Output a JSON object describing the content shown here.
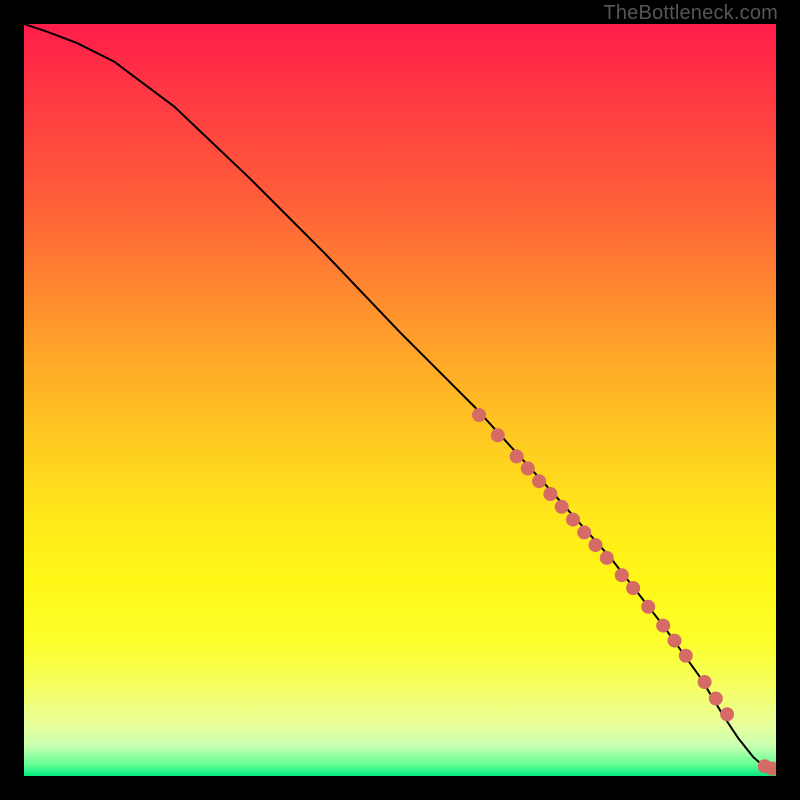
{
  "attribution": "TheBottleneck.com",
  "chart_data": {
    "type": "line",
    "title": "",
    "xlabel": "",
    "ylabel": "",
    "xlim": [
      0,
      100
    ],
    "ylim": [
      0,
      100
    ],
    "grid": false,
    "legend": false,
    "curve": {
      "name": "bottleneck-curve",
      "x": [
        0,
        3,
        7,
        12,
        20,
        30,
        40,
        50,
        60,
        70,
        78,
        85,
        90,
        93,
        95,
        97,
        98.5,
        100
      ],
      "y": [
        100,
        99,
        97.5,
        95,
        89,
        79.5,
        69.5,
        59,
        49,
        38,
        29,
        20,
        13,
        8,
        5,
        2.5,
        1.2,
        1.0
      ]
    },
    "points": {
      "name": "highlighted-samples",
      "color": "#d66a65",
      "xy": [
        [
          60.5,
          48.0
        ],
        [
          63.0,
          45.3
        ],
        [
          65.5,
          42.5
        ],
        [
          67.0,
          40.9
        ],
        [
          68.5,
          39.2
        ],
        [
          70.0,
          37.5
        ],
        [
          71.5,
          35.8
        ],
        [
          73.0,
          34.1
        ],
        [
          74.5,
          32.4
        ],
        [
          76.0,
          30.7
        ],
        [
          77.5,
          29.0
        ],
        [
          79.5,
          26.7
        ],
        [
          81.0,
          25.0
        ],
        [
          83.0,
          22.5
        ],
        [
          85.0,
          20.0
        ],
        [
          86.5,
          18.0
        ],
        [
          88.0,
          16.0
        ],
        [
          90.5,
          12.5
        ],
        [
          92.0,
          10.3
        ],
        [
          93.5,
          8.2
        ],
        [
          98.5,
          1.3
        ],
        [
          99.5,
          1.0
        ]
      ]
    }
  }
}
